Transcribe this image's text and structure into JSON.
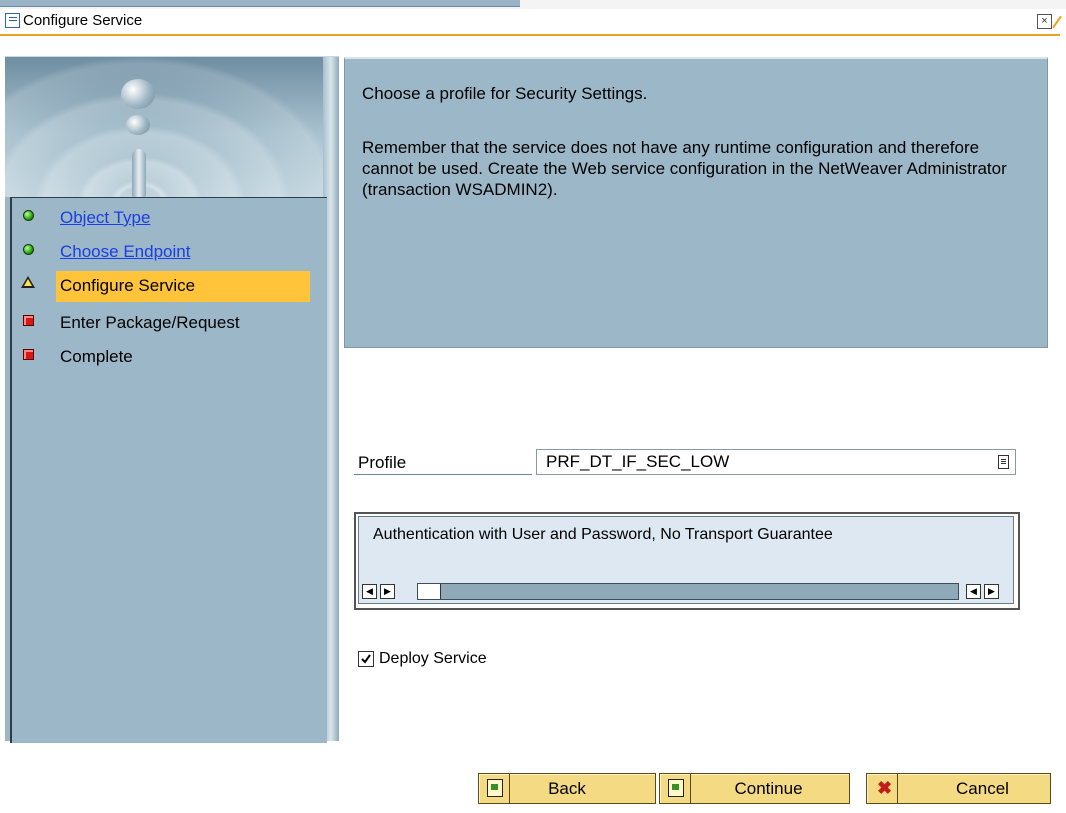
{
  "window": {
    "title": "Configure Service"
  },
  "steps": [
    {
      "label": "Object Type",
      "status": "done",
      "link": true
    },
    {
      "label": "Choose Endpoint",
      "status": "done",
      "link": true
    },
    {
      "label": "Configure Service",
      "status": "current",
      "link": false
    },
    {
      "label": "Enter Package/Request",
      "status": "pending",
      "link": false
    },
    {
      "label": "Complete",
      "status": "pending",
      "link": false
    }
  ],
  "info": {
    "line1": "Choose a profile for Security Settings.",
    "line2": "Remember that the service does not have any runtime configuration and therefore cannot be used. Create the Web service configuration in the NetWeaver Administrator (transaction WSADMIN2)."
  },
  "profile": {
    "label": "Profile",
    "value": "PRF_DT_IF_SEC_LOW",
    "description": "Authentication with User and Password, No Transport Guarantee"
  },
  "deploy": {
    "label": "Deploy Service",
    "checked": true
  },
  "buttons": {
    "back": "Back",
    "continue": "Continue",
    "cancel": "Cancel"
  },
  "colors": {
    "accent": "#f0a020",
    "panel": "#9cb8c8",
    "active_step": "#ffc43a",
    "button": "#f5da84"
  }
}
